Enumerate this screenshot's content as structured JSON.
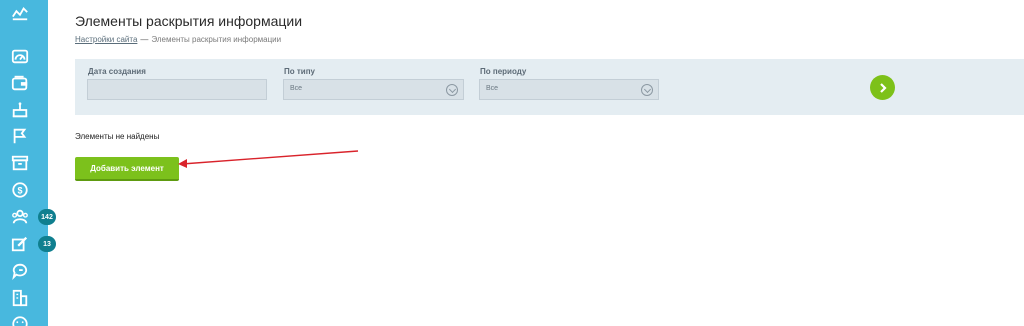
{
  "sidebar": {
    "items": [
      {
        "icon": "stats-icon"
      },
      {
        "icon": "dashboard-icon"
      },
      {
        "icon": "wallet-icon"
      },
      {
        "icon": "cake-icon"
      },
      {
        "icon": "flag-icon"
      },
      {
        "icon": "archive-icon"
      },
      {
        "icon": "coin-icon"
      },
      {
        "icon": "users-icon",
        "badge": "142"
      },
      {
        "icon": "edit-icon",
        "badge": "13"
      },
      {
        "icon": "chat-icon"
      },
      {
        "icon": "building-icon"
      },
      {
        "icon": "smile-icon"
      }
    ]
  },
  "page": {
    "title": "Элементы раскрытия информации",
    "breadcrumb": {
      "link": "Настройки сайта",
      "separator": "—",
      "current": "Элементы раскрытия информации"
    }
  },
  "filters": {
    "created_label": "Дата создания",
    "type_label": "По типу",
    "type_value": "Все",
    "period_label": "По периоду",
    "period_value": "Все"
  },
  "content": {
    "empty_text": "Элементы не найдены",
    "add_button": "Добавить элемент"
  },
  "colors": {
    "sidebar": "#48b8de",
    "accent_green": "#7cc11c",
    "badge": "#0f7f8f",
    "arrow_annotation": "#d9232b"
  }
}
